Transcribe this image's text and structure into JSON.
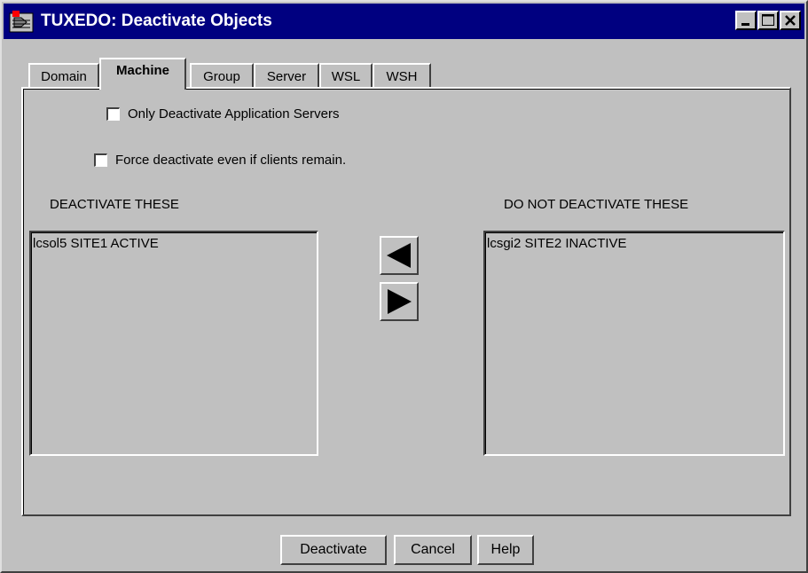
{
  "window": {
    "title": "TUXEDO: Deactivate Objects"
  },
  "tabs": [
    {
      "label": "Domain"
    },
    {
      "label": "Machine"
    },
    {
      "label": "Group"
    },
    {
      "label": "Server"
    },
    {
      "label": "WSL"
    },
    {
      "label": "WSH"
    }
  ],
  "active_tab": "Machine",
  "options": {
    "only_app_servers": {
      "label": "Only Deactivate Application Servers",
      "checked": false
    },
    "force_deactivate": {
      "label": "Force deactivate even if clients remain.",
      "checked": false
    }
  },
  "lists": {
    "deactivate": {
      "header": "DEACTIVATE THESE",
      "items": [
        "lcsol5 SITE1 ACTIVE"
      ]
    },
    "keep": {
      "header": "DO NOT DEACTIVATE THESE",
      "items": [
        "lcsgi2 SITE2 INACTIVE"
      ]
    }
  },
  "icons": {
    "move_left": "left-triangle-arrow",
    "move_right": "right-triangle-arrow"
  },
  "buttons": {
    "deactivate": "Deactivate",
    "cancel": "Cancel",
    "help": "Help"
  }
}
